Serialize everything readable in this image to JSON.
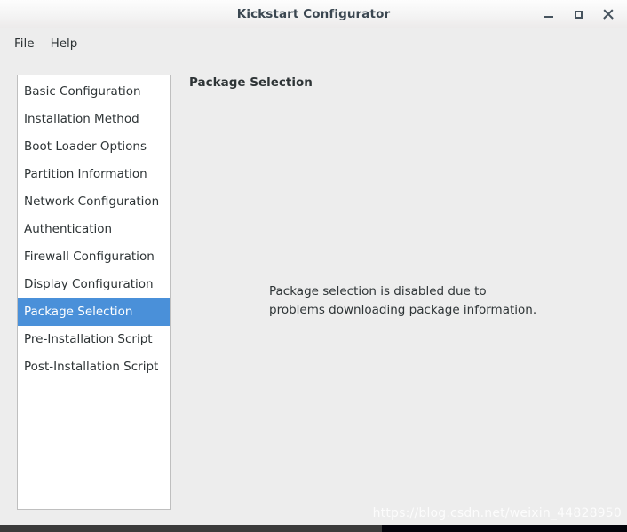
{
  "window": {
    "title": "Kickstart Configurator",
    "controls": [
      {
        "name": "minimize-button",
        "glyph": "minimize"
      },
      {
        "name": "maximize-button",
        "glyph": "maximize"
      },
      {
        "name": "close-button",
        "glyph": "close"
      }
    ]
  },
  "menubar": {
    "items": [
      {
        "label": "File"
      },
      {
        "label": "Help"
      }
    ]
  },
  "sidebar": {
    "items": [
      {
        "label": "Basic Configuration",
        "selected": false
      },
      {
        "label": "Installation Method",
        "selected": false
      },
      {
        "label": "Boot Loader Options",
        "selected": false
      },
      {
        "label": "Partition Information",
        "selected": false
      },
      {
        "label": "Network Configuration",
        "selected": false
      },
      {
        "label": "Authentication",
        "selected": false
      },
      {
        "label": "Firewall Configuration",
        "selected": false
      },
      {
        "label": "Display Configuration",
        "selected": false
      },
      {
        "label": "Package Selection",
        "selected": true
      },
      {
        "label": "Pre-Installation Script",
        "selected": false
      },
      {
        "label": "Post-Installation Script",
        "selected": false
      }
    ]
  },
  "main": {
    "heading": "Package Selection",
    "message_line1": "Package selection is disabled due to",
    "message_line2": "problems downloading package information."
  },
  "watermark": {
    "text": "https://blog.csdn.net/weixin_44828950"
  },
  "colors": {
    "selection_blue": "#4a90d9",
    "window_background": "#ededed",
    "list_background": "#ffffff",
    "text": "#2e3436",
    "title_text": "#3b4751"
  }
}
